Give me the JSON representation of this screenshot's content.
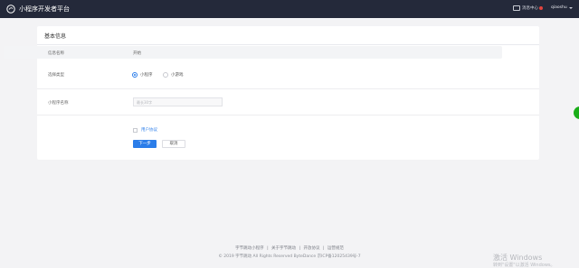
{
  "topbar": {
    "title": "小程序开发者平台",
    "messages_label": "消息中心",
    "username": "qiaoshu"
  },
  "card": {
    "title": "基本信息",
    "rows": [
      {
        "label": "信息名称",
        "value": "开始"
      },
      {
        "label": "选择类型"
      },
      {
        "label": "小程序名称"
      }
    ],
    "type_options": [
      {
        "label": "小程序",
        "selected": true
      },
      {
        "label": "小游戏",
        "selected": false
      }
    ],
    "name_placeholder": "最长30字",
    "agreement_label": "用户协议",
    "next_label": "下一步",
    "cancel_label": "取消"
  },
  "footer": {
    "links": [
      "字节跳动小程序",
      "关于字节跳动",
      "开放协议",
      "运营规范"
    ],
    "separator": "|",
    "copyright": "© 2019 字节跳动 All Rights Reserved ByteDance 京ICP备12025439号-7"
  },
  "watermark": {
    "line1": "激活 Windows",
    "line2": "转到\"设置\"以激活 Windows。"
  },
  "colors": {
    "topbar": "#24293a",
    "accent": "#2b7de9",
    "float_button": "#1aad19"
  }
}
